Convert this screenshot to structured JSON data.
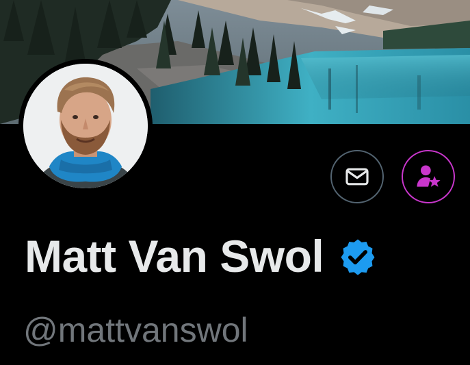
{
  "profile": {
    "display_name": "Matt Van Swol",
    "handle": "@mattvanswol",
    "verified": true,
    "verified_icon": "verified-badge-icon"
  },
  "actions": {
    "message_icon": "envelope-icon",
    "subscribe_icon": "person-star-icon"
  },
  "colors": {
    "background": "#000000",
    "name_text": "#e7e9ea",
    "handle_text": "#71767b",
    "verified_blue": "#1d9bf0",
    "message_border": "#536471",
    "subscribe_accent": "#c936cc"
  }
}
